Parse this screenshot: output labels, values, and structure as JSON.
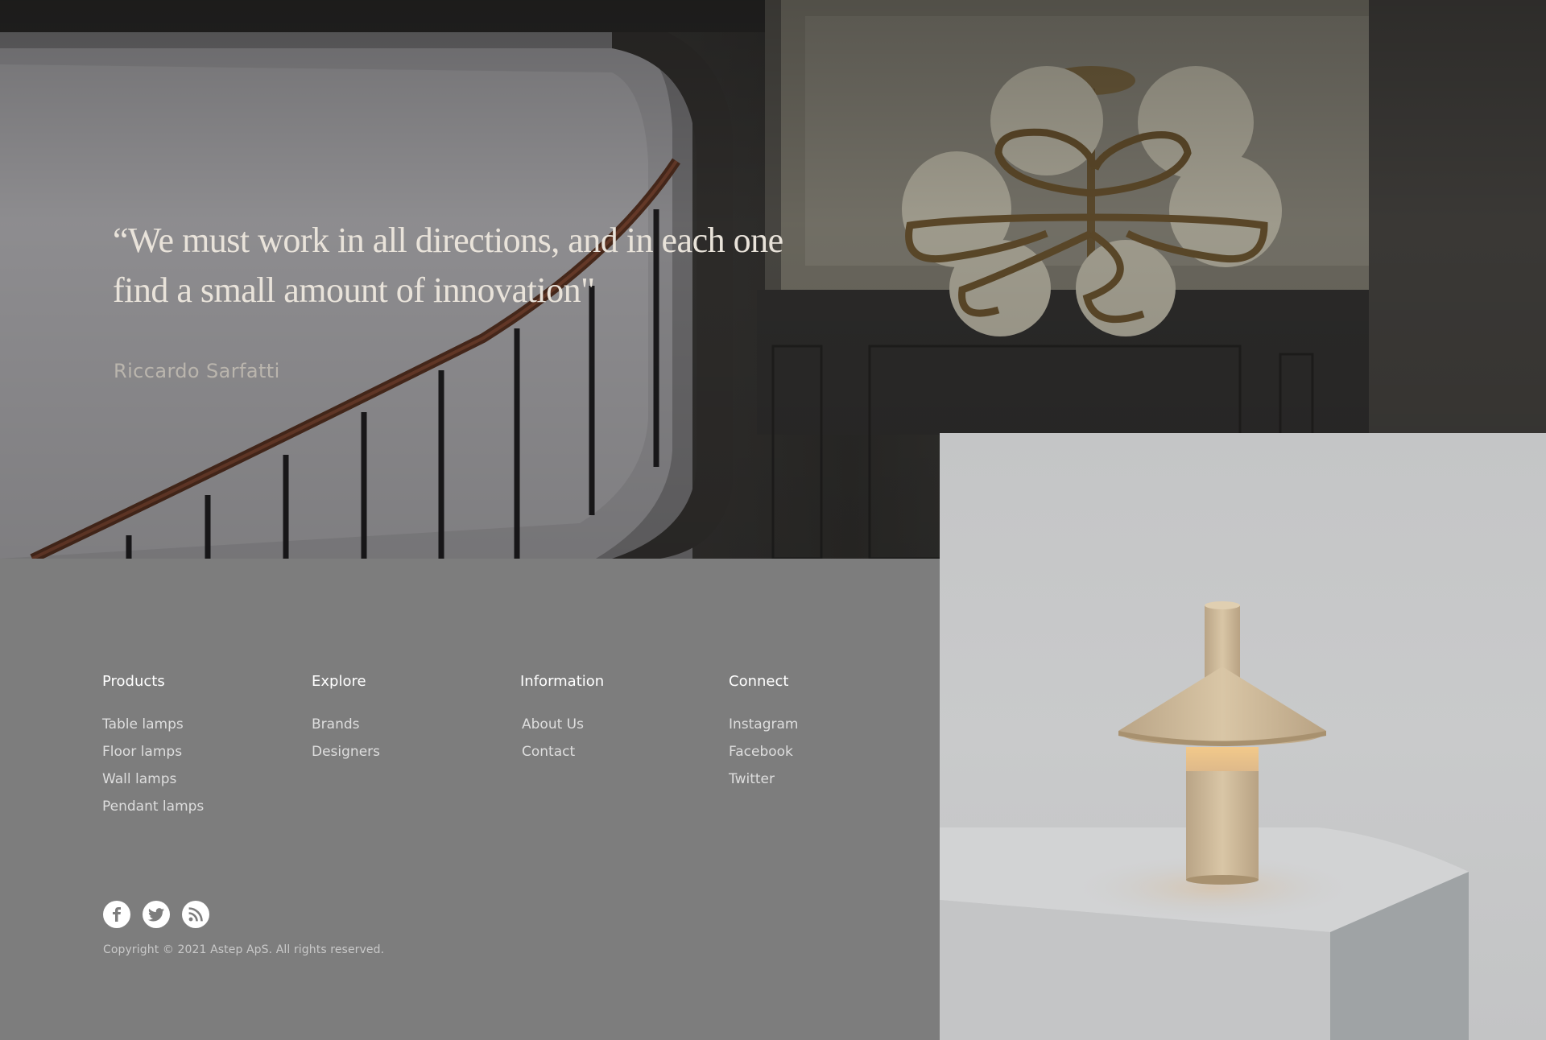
{
  "hero": {
    "quote_line1": "“We must work in all directions, and in each one",
    "quote_line2": " find a small amount of innovation\"",
    "author": "Riccardo Sarfatti"
  },
  "footer": {
    "columns": [
      {
        "heading": "Products",
        "links": [
          "Table lamps",
          "Floor lamps",
          "Wall lamps",
          "Pendant lamps"
        ]
      },
      {
        "heading": "Explore",
        "links": [
          "Brands",
          "Designers"
        ]
      },
      {
        "heading": "Information",
        "links": [
          "About Us",
          "Contact"
        ]
      },
      {
        "heading": "Connect",
        "links": [
          "Instagram",
          "Facebook",
          "Twitter"
        ]
      }
    ],
    "social_icons": [
      "facebook-icon",
      "twitter-icon",
      "rss-icon"
    ],
    "copyright": "Copyright © 2021 Astep ApS. All rights reserved."
  },
  "colors": {
    "footer_bg": "#7d7d7d",
    "quote_text": "#e9e3da",
    "author_text": "#bab5ad",
    "heading_text": "#ffffff",
    "link_text": "#dedede"
  }
}
